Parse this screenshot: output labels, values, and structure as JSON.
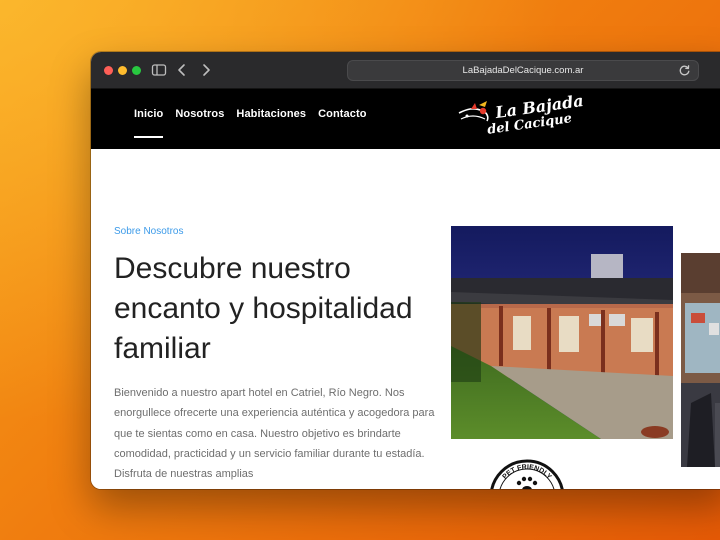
{
  "browser": {
    "url": "LaBajadaDelCacique.com.ar"
  },
  "nav": {
    "items": [
      {
        "label": "Inicio",
        "active": true
      },
      {
        "label": "Nosotros",
        "active": false
      },
      {
        "label": "Habitaciones",
        "active": false
      },
      {
        "label": "Contacto",
        "active": false
      }
    ]
  },
  "logo": {
    "line1": "La Bajada",
    "line2": "del Cacique"
  },
  "about": {
    "eyebrow": "Sobre Nosotros",
    "headline": "Descubre nuestro encanto y hospitalidad familiar",
    "body": "Bienvenido a nuestro apart hotel en Catriel, Río Negro. Nos enorgullece ofrecerte una experiencia auténtica y acogedora para que te sientas como en casa. Nuestro objetivo es brindarte comodidad, practicidad y un servicio familiar durante tu estadía. Disfruta de nuestras amplias"
  },
  "badge": {
    "text": "PET FRIENDLY"
  },
  "colors": {
    "accent": "#3d9be9",
    "header_bg": "#000000",
    "background_orange": "#f07d0f"
  }
}
